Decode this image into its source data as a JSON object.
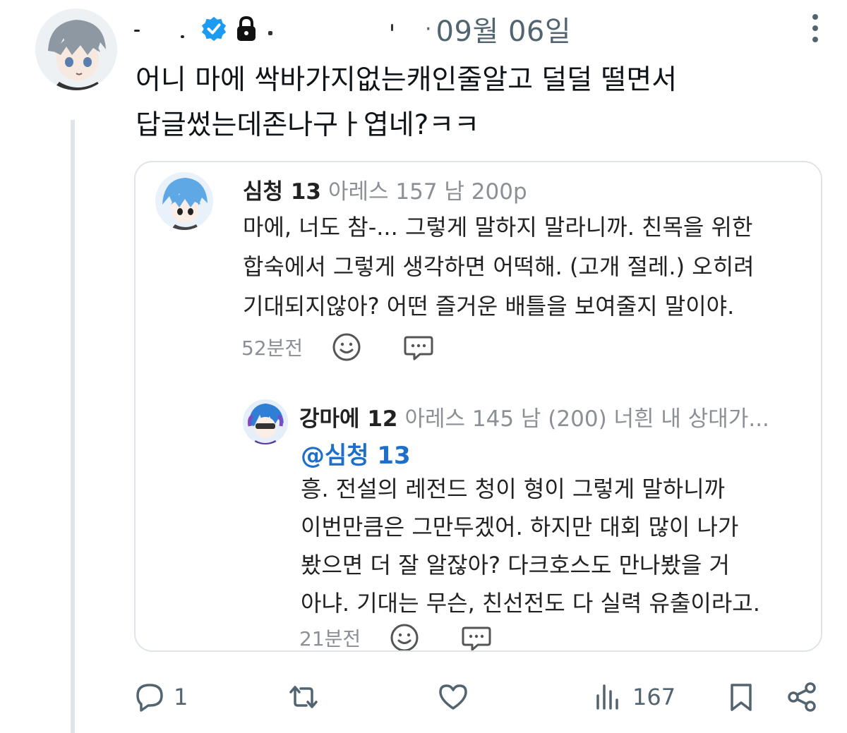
{
  "tweet": {
    "date_sep": "·",
    "date": "09월 06일",
    "text_lines": [
      "어니 마에 싹바가지없는캐인줄알고 덜덜 떨면서",
      "답글썼는데존나구ㅏ엽네?ㅋㅋ"
    ]
  },
  "quoted": {
    "comment1": {
      "name": "심청 13",
      "meta": "아레스 157 남 200p",
      "lines": [
        "마에, 너도 참-... 그렇게 말하지 말라니까. 친목을 위한",
        "합숙에서 그렇게 생각하면 어떡해. (고개 절레.) 오히려",
        "기대되지않아? 어떤 즐거운 배틀을 보여줄지 말이야."
      ],
      "time": "52분전"
    },
    "comment2": {
      "name": "강마에 12",
      "meta": "아레스 145 남 (200) 너흰 내 상대가...",
      "mention": "@심청 13",
      "lines": [
        "흥. 전설의 레전드 청이 형이 그렇게 말하니까",
        "이번만큼은 그만두겠어. 하지만 대회 많이 나가",
        "봤으면 더 잘 알잖아? 다크호스도 만나봤을 거",
        "아냐. 기대는 무슨, 친선전도 다 실력 유출이라고."
      ],
      "time": "21분전"
    }
  },
  "actions": {
    "reply_count": "1",
    "retweet_count": "",
    "like_count": "",
    "views_count": "167"
  },
  "icons": [
    "verified-badge-icon",
    "lock-icon",
    "more-icon",
    "smile-icon",
    "comment-bubble-icon",
    "reply-icon",
    "retweet-icon",
    "like-icon",
    "views-icon",
    "bookmark-icon",
    "share-icon"
  ],
  "colors": {
    "verified": "#1d9bf0",
    "mention": "#1d6fc9",
    "muted": "#536471",
    "thread_line": "#dfe3ea"
  }
}
